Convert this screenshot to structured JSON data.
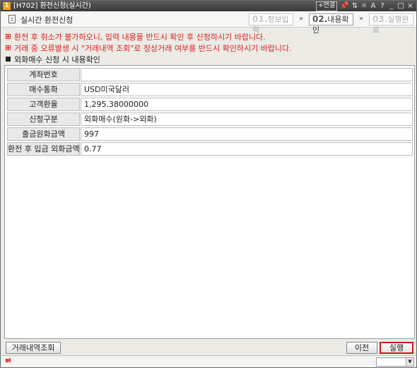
{
  "window": {
    "badge": "1",
    "title": "[H702] 환전신청(실시간)",
    "tools": [
      "+연결",
      "📌",
      "⇅",
      "☼",
      "A",
      "?",
      "_",
      "□",
      "×"
    ]
  },
  "header": {
    "title": "실시간 환전신청",
    "steps": [
      {
        "num": "01.",
        "label": "정보입력",
        "active": false
      },
      {
        "num": "02.",
        "label": "내용확인",
        "active": true
      },
      {
        "num": "03.",
        "label": "실행완료",
        "active": false
      }
    ],
    "arrow": "»"
  },
  "notices": [
    "환전 후 취소가 불가하오니, 입력 내용을 반드시 확인 후 신청하시기 바랍니다.",
    "거래 중 오류발생 시 \"거래내역 조회\"로 정상거래 여부를 반드시 확인하시기 바랍니다."
  ],
  "section_title": "외화매수 신청 시 내용확인",
  "form": {
    "rows": [
      {
        "label": "계좌번호",
        "value": ""
      },
      {
        "label": "매수통화",
        "value": "USD미국달러"
      },
      {
        "label": "고객환율",
        "value": "1,295.38000000"
      },
      {
        "label": "신청구분",
        "value": "외화매수(원화->외화)"
      },
      {
        "label": "출금원화금액",
        "value": "997"
      },
      {
        "label": "환전 후 입금 외화금액",
        "value": "0.77"
      }
    ]
  },
  "buttons": {
    "history": "거래내역조회",
    "prev": "이전",
    "execute": "실행"
  },
  "colors": {
    "notice": "#e02020",
    "primary_border": "#d01818",
    "titlebar": "#4a4a4a"
  },
  "icons": {
    "speaker": "speaker-icon",
    "document": "document-icon"
  }
}
